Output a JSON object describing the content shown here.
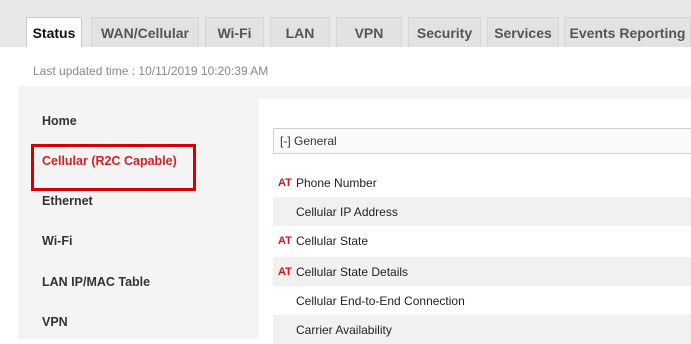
{
  "tabs": [
    {
      "label": "Status",
      "active": true
    },
    {
      "label": "WAN/Cellular",
      "active": false
    },
    {
      "label": "Wi-Fi",
      "active": false
    },
    {
      "label": "LAN",
      "active": false
    },
    {
      "label": "VPN",
      "active": false
    },
    {
      "label": "Security",
      "active": false
    },
    {
      "label": "Services",
      "active": false
    },
    {
      "label": "Events Reporting",
      "active": false
    }
  ],
  "last_updated": "Last updated time : 10/11/2019 10:20:39 AM",
  "sidebar": {
    "items": [
      {
        "label": "Home",
        "active": false
      },
      {
        "label": "Cellular (R2C Capable)",
        "active": true
      },
      {
        "label": "Ethernet",
        "active": false
      },
      {
        "label": "Wi-Fi",
        "active": false
      },
      {
        "label": "LAN IP/MAC Table",
        "active": false
      },
      {
        "label": "VPN",
        "active": false
      }
    ]
  },
  "general": {
    "header": "[-] General",
    "at_marker": "AT",
    "rows": [
      {
        "label": "Phone Number",
        "at": true
      },
      {
        "label": "Cellular IP Address",
        "at": false
      },
      {
        "label": "Cellular State",
        "at": true
      },
      {
        "label": "Cellular State Details",
        "at": true
      },
      {
        "label": "Cellular End-to-End Connection",
        "at": false
      },
      {
        "label": "Carrier Availability",
        "at": false
      }
    ]
  },
  "colors": {
    "accent_red": "#d40000",
    "active_text": "#d42020"
  }
}
